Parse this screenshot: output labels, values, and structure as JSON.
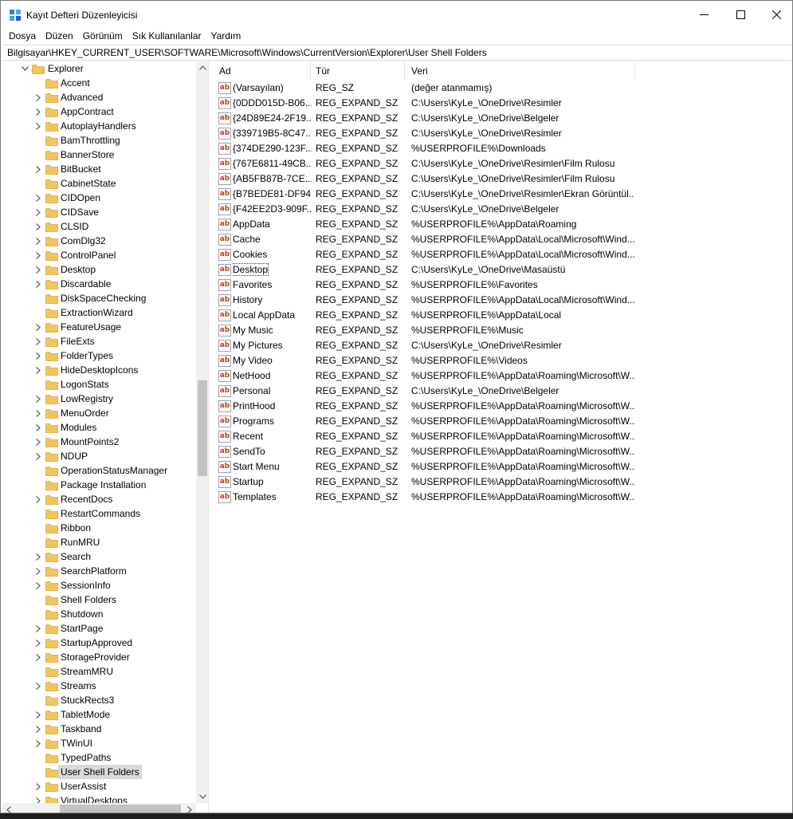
{
  "window": {
    "title": "Kayıt Defteri Düzenleyicisi"
  },
  "menu": [
    "Dosya",
    "Düzen",
    "Görünüm",
    "Sık Kullanılanlar",
    "Yardım"
  ],
  "address": "Bilgisayar\\HKEY_CURRENT_USER\\SOFTWARE\\Microsoft\\Windows\\CurrentVersion\\Explorer\\User Shell Folders",
  "tree": {
    "parent": "Explorer",
    "children": [
      {
        "label": "Accent",
        "expandable": false
      },
      {
        "label": "Advanced",
        "expandable": true
      },
      {
        "label": "AppContract",
        "expandable": true
      },
      {
        "label": "AutoplayHandlers",
        "expandable": true
      },
      {
        "label": "BamThrottling",
        "expandable": false
      },
      {
        "label": "BannerStore",
        "expandable": false
      },
      {
        "label": "BitBucket",
        "expandable": true
      },
      {
        "label": "CabinetState",
        "expandable": false
      },
      {
        "label": "CIDOpen",
        "expandable": true
      },
      {
        "label": "CIDSave",
        "expandable": true
      },
      {
        "label": "CLSID",
        "expandable": true
      },
      {
        "label": "ComDlg32",
        "expandable": true
      },
      {
        "label": "ControlPanel",
        "expandable": true
      },
      {
        "label": "Desktop",
        "expandable": true
      },
      {
        "label": "Discardable",
        "expandable": true
      },
      {
        "label": "DiskSpaceChecking",
        "expandable": false
      },
      {
        "label": "ExtractionWizard",
        "expandable": false
      },
      {
        "label": "FeatureUsage",
        "expandable": true
      },
      {
        "label": "FileExts",
        "expandable": true
      },
      {
        "label": "FolderTypes",
        "expandable": true
      },
      {
        "label": "HideDesktopIcons",
        "expandable": true
      },
      {
        "label": "LogonStats",
        "expandable": false
      },
      {
        "label": "LowRegistry",
        "expandable": true
      },
      {
        "label": "MenuOrder",
        "expandable": true
      },
      {
        "label": "Modules",
        "expandable": true
      },
      {
        "label": "MountPoints2",
        "expandable": true
      },
      {
        "label": "NDUP",
        "expandable": true
      },
      {
        "label": "OperationStatusManager",
        "expandable": false
      },
      {
        "label": "Package Installation",
        "expandable": false
      },
      {
        "label": "RecentDocs",
        "expandable": true
      },
      {
        "label": "RestartCommands",
        "expandable": false
      },
      {
        "label": "Ribbon",
        "expandable": false
      },
      {
        "label": "RunMRU",
        "expandable": false
      },
      {
        "label": "Search",
        "expandable": true
      },
      {
        "label": "SearchPlatform",
        "expandable": true
      },
      {
        "label": "SessionInfo",
        "expandable": true
      },
      {
        "label": "Shell Folders",
        "expandable": false
      },
      {
        "label": "Shutdown",
        "expandable": false
      },
      {
        "label": "StartPage",
        "expandable": true
      },
      {
        "label": "StartupApproved",
        "expandable": true
      },
      {
        "label": "StorageProvider",
        "expandable": true
      },
      {
        "label": "StreamMRU",
        "expandable": false
      },
      {
        "label": "Streams",
        "expandable": true
      },
      {
        "label": "StuckRects3",
        "expandable": false
      },
      {
        "label": "TabletMode",
        "expandable": true
      },
      {
        "label": "Taskband",
        "expandable": true
      },
      {
        "label": "TWinUI",
        "expandable": true
      },
      {
        "label": "TypedPaths",
        "expandable": false
      },
      {
        "label": "User Shell Folders",
        "expandable": false,
        "selected": true
      },
      {
        "label": "UserAssist",
        "expandable": true
      },
      {
        "label": "VirtualDesktops",
        "expandable": true
      }
    ]
  },
  "columns": {
    "name": "Ad",
    "type": "Tür",
    "data": "Veri"
  },
  "values": [
    {
      "name": "(Varsayılan)",
      "type": "REG_SZ",
      "data": "(değer atanmamış)"
    },
    {
      "name": "{0DDD015D-B06...",
      "type": "REG_EXPAND_SZ",
      "data": "C:\\Users\\KyLe_\\OneDrive\\Resimler"
    },
    {
      "name": "{24D89E24-2F19...",
      "type": "REG_EXPAND_SZ",
      "data": "C:\\Users\\KyLe_\\OneDrive\\Belgeler"
    },
    {
      "name": "{339719B5-8C47...",
      "type": "REG_EXPAND_SZ",
      "data": "C:\\Users\\KyLe_\\OneDrive\\Resimler"
    },
    {
      "name": "{374DE290-123F...",
      "type": "REG_EXPAND_SZ",
      "data": "%USERPROFILE%\\Downloads"
    },
    {
      "name": "{767E6811-49CB...",
      "type": "REG_EXPAND_SZ",
      "data": "C:\\Users\\KyLe_\\OneDrive\\Resimler\\Film Rulosu"
    },
    {
      "name": "{AB5FB87B-7CE...",
      "type": "REG_EXPAND_SZ",
      "data": "C:\\Users\\KyLe_\\OneDrive\\Resimler\\Film Rulosu"
    },
    {
      "name": "{B7BEDE81-DF94...",
      "type": "REG_EXPAND_SZ",
      "data": "C:\\Users\\KyLe_\\OneDrive\\Resimler\\Ekran Görüntül..."
    },
    {
      "name": "{F42EE2D3-909F...",
      "type": "REG_EXPAND_SZ",
      "data": "C:\\Users\\KyLe_\\OneDrive\\Belgeler"
    },
    {
      "name": "AppData",
      "type": "REG_EXPAND_SZ",
      "data": "%USERPROFILE%\\AppData\\Roaming"
    },
    {
      "name": "Cache",
      "type": "REG_EXPAND_SZ",
      "data": "%USERPROFILE%\\AppData\\Local\\Microsoft\\Wind..."
    },
    {
      "name": "Cookies",
      "type": "REG_EXPAND_SZ",
      "data": "%USERPROFILE%\\AppData\\Local\\Microsoft\\Wind..."
    },
    {
      "name": "Desktop",
      "type": "REG_EXPAND_SZ",
      "data": "C:\\Users\\KyLe_\\OneDrive\\Masaüstü",
      "focused": true
    },
    {
      "name": "Favorites",
      "type": "REG_EXPAND_SZ",
      "data": "%USERPROFILE%\\Favorites"
    },
    {
      "name": "History",
      "type": "REG_EXPAND_SZ",
      "data": "%USERPROFILE%\\AppData\\Local\\Microsoft\\Wind..."
    },
    {
      "name": "Local AppData",
      "type": "REG_EXPAND_SZ",
      "data": "%USERPROFILE%\\AppData\\Local"
    },
    {
      "name": "My Music",
      "type": "REG_EXPAND_SZ",
      "data": "%USERPROFILE%\\Music"
    },
    {
      "name": "My Pictures",
      "type": "REG_EXPAND_SZ",
      "data": "C:\\Users\\KyLe_\\OneDrive\\Resimler"
    },
    {
      "name": "My Video",
      "type": "REG_EXPAND_SZ",
      "data": "%USERPROFILE%\\Videos"
    },
    {
      "name": "NetHood",
      "type": "REG_EXPAND_SZ",
      "data": "%USERPROFILE%\\AppData\\Roaming\\Microsoft\\W..."
    },
    {
      "name": "Personal",
      "type": "REG_EXPAND_SZ",
      "data": "C:\\Users\\KyLe_\\OneDrive\\Belgeler"
    },
    {
      "name": "PrintHood",
      "type": "REG_EXPAND_SZ",
      "data": "%USERPROFILE%\\AppData\\Roaming\\Microsoft\\W..."
    },
    {
      "name": "Programs",
      "type": "REG_EXPAND_SZ",
      "data": "%USERPROFILE%\\AppData\\Roaming\\Microsoft\\W..."
    },
    {
      "name": "Recent",
      "type": "REG_EXPAND_SZ",
      "data": "%USERPROFILE%\\AppData\\Roaming\\Microsoft\\W..."
    },
    {
      "name": "SendTo",
      "type": "REG_EXPAND_SZ",
      "data": "%USERPROFILE%\\AppData\\Roaming\\Microsoft\\W..."
    },
    {
      "name": "Start Menu",
      "type": "REG_EXPAND_SZ",
      "data": "%USERPROFILE%\\AppData\\Roaming\\Microsoft\\W..."
    },
    {
      "name": "Startup",
      "type": "REG_EXPAND_SZ",
      "data": "%USERPROFILE%\\AppData\\Roaming\\Microsoft\\W..."
    },
    {
      "name": "Templates",
      "type": "REG_EXPAND_SZ",
      "data": "%USERPROFILE%\\AppData\\Roaming\\Microsoft\\W..."
    }
  ],
  "icons": {
    "app": "registry-editor-icon",
    "value": "string-value-icon",
    "folder": "folder-icon",
    "expand": "chevron-right-icon",
    "expanded": "chevron-down-icon"
  },
  "colors": {
    "folder": "#f2c55c",
    "selection": "#d9d9d9",
    "value_icon_text": "#b0451a"
  }
}
